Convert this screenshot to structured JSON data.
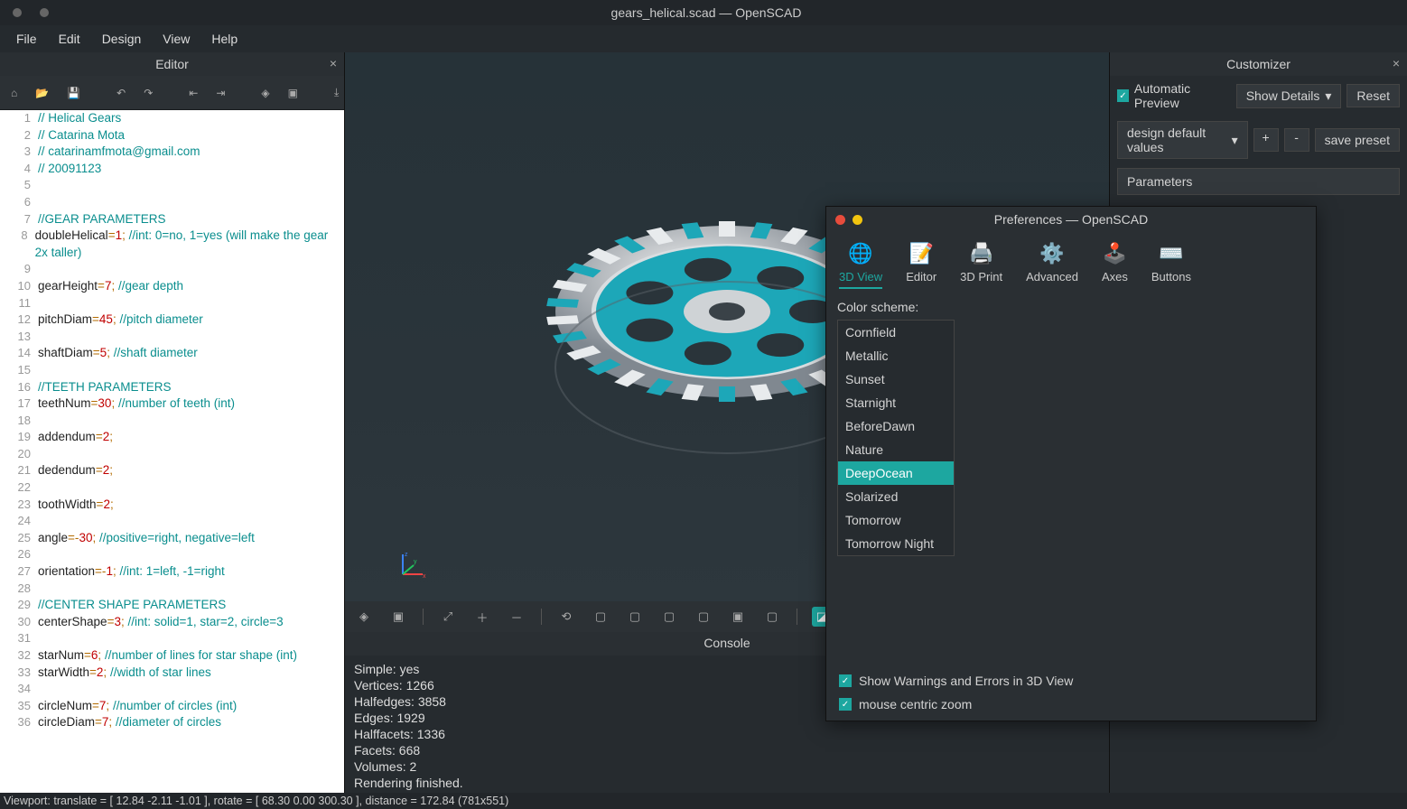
{
  "window": {
    "title": "gears_helical.scad — OpenSCAD"
  },
  "menu": {
    "file": "File",
    "edit": "Edit",
    "design": "Design",
    "view": "View",
    "help": "Help"
  },
  "editor": {
    "title": "Editor",
    "lines": [
      {
        "n": 1,
        "segs": [
          {
            "t": "// Helical Gears",
            "c": "cmt"
          }
        ]
      },
      {
        "n": 2,
        "segs": [
          {
            "t": "// Catarina Mota",
            "c": "cmt"
          }
        ]
      },
      {
        "n": 3,
        "segs": [
          {
            "t": "// catarinamfmota@gmail.com",
            "c": "cmt"
          }
        ]
      },
      {
        "n": 4,
        "segs": [
          {
            "t": "// 20091123",
            "c": "cmt"
          }
        ]
      },
      {
        "n": 5,
        "segs": []
      },
      {
        "n": 6,
        "segs": []
      },
      {
        "n": 7,
        "segs": [
          {
            "t": "//GEAR PARAMETERS",
            "c": "cmt"
          }
        ]
      },
      {
        "n": 8,
        "segs": [
          {
            "t": "doubleHelical",
            "c": ""
          },
          {
            "t": "=",
            "c": "op"
          },
          {
            "t": "1",
            "c": "num"
          },
          {
            "t": "; ",
            "c": "op"
          },
          {
            "t": "//int: 0=no, 1=yes (will make the gear 2x taller)",
            "c": "cmt"
          }
        ]
      },
      {
        "n": 9,
        "segs": []
      },
      {
        "n": 10,
        "segs": [
          {
            "t": "gearHeight",
            "c": ""
          },
          {
            "t": "=",
            "c": "op"
          },
          {
            "t": "7",
            "c": "num"
          },
          {
            "t": "; ",
            "c": "op"
          },
          {
            "t": "//gear depth",
            "c": "cmt"
          }
        ]
      },
      {
        "n": 11,
        "segs": []
      },
      {
        "n": 12,
        "segs": [
          {
            "t": "pitchDiam",
            "c": ""
          },
          {
            "t": "=",
            "c": "op"
          },
          {
            "t": "45",
            "c": "num"
          },
          {
            "t": "; ",
            "c": "op"
          },
          {
            "t": "//pitch diameter",
            "c": "cmt"
          }
        ]
      },
      {
        "n": 13,
        "segs": []
      },
      {
        "n": 14,
        "segs": [
          {
            "t": "shaftDiam",
            "c": ""
          },
          {
            "t": "=",
            "c": "op"
          },
          {
            "t": "5",
            "c": "num"
          },
          {
            "t": "; ",
            "c": "op"
          },
          {
            "t": "//shaft diameter",
            "c": "cmt"
          }
        ]
      },
      {
        "n": 15,
        "segs": []
      },
      {
        "n": 16,
        "segs": [
          {
            "t": "//TEETH PARAMETERS",
            "c": "cmt"
          }
        ]
      },
      {
        "n": 17,
        "segs": [
          {
            "t": "teethNum",
            "c": ""
          },
          {
            "t": "=",
            "c": "op"
          },
          {
            "t": "30",
            "c": "num"
          },
          {
            "t": "; ",
            "c": "op"
          },
          {
            "t": "//number of teeth (int)",
            "c": "cmt"
          }
        ]
      },
      {
        "n": 18,
        "segs": []
      },
      {
        "n": 19,
        "segs": [
          {
            "t": "addendum",
            "c": ""
          },
          {
            "t": "=",
            "c": "op"
          },
          {
            "t": "2",
            "c": "num"
          },
          {
            "t": ";",
            "c": "op"
          }
        ]
      },
      {
        "n": 20,
        "segs": []
      },
      {
        "n": 21,
        "segs": [
          {
            "t": "dedendum",
            "c": ""
          },
          {
            "t": "=",
            "c": "op"
          },
          {
            "t": "2",
            "c": "num"
          },
          {
            "t": ";",
            "c": "op"
          }
        ]
      },
      {
        "n": 22,
        "segs": []
      },
      {
        "n": 23,
        "segs": [
          {
            "t": "toothWidth",
            "c": ""
          },
          {
            "t": "=",
            "c": "op"
          },
          {
            "t": "2",
            "c": "num"
          },
          {
            "t": ";",
            "c": "op"
          }
        ]
      },
      {
        "n": 24,
        "segs": []
      },
      {
        "n": 25,
        "segs": [
          {
            "t": "angle",
            "c": ""
          },
          {
            "t": "=-",
            "c": "op"
          },
          {
            "t": "30",
            "c": "num"
          },
          {
            "t": "; ",
            "c": "op"
          },
          {
            "t": "//positive=right, negative=left",
            "c": "cmt"
          }
        ]
      },
      {
        "n": 26,
        "segs": []
      },
      {
        "n": 27,
        "segs": [
          {
            "t": "orientation",
            "c": ""
          },
          {
            "t": "=-",
            "c": "op"
          },
          {
            "t": "1",
            "c": "num"
          },
          {
            "t": "; ",
            "c": "op"
          },
          {
            "t": "//int: 1=left, -1=right",
            "c": "cmt"
          }
        ]
      },
      {
        "n": 28,
        "segs": []
      },
      {
        "n": 29,
        "segs": [
          {
            "t": "//CENTER SHAPE PARAMETERS",
            "c": "cmt"
          }
        ]
      },
      {
        "n": 30,
        "segs": [
          {
            "t": "centerShape",
            "c": ""
          },
          {
            "t": "=",
            "c": "op"
          },
          {
            "t": "3",
            "c": "num"
          },
          {
            "t": "; ",
            "c": "op"
          },
          {
            "t": "//int: solid=1, star=2, circle=3",
            "c": "cmt"
          }
        ]
      },
      {
        "n": 31,
        "segs": []
      },
      {
        "n": 32,
        "segs": [
          {
            "t": "starNum",
            "c": ""
          },
          {
            "t": "=",
            "c": "op"
          },
          {
            "t": "6",
            "c": "num"
          },
          {
            "t": "; ",
            "c": "op"
          },
          {
            "t": "//number of lines for star shape (int)",
            "c": "cmt"
          }
        ]
      },
      {
        "n": 33,
        "segs": [
          {
            "t": "starWidth",
            "c": ""
          },
          {
            "t": "=",
            "c": "op"
          },
          {
            "t": "2",
            "c": "num"
          },
          {
            "t": "; ",
            "c": "op"
          },
          {
            "t": "//width of star lines",
            "c": "cmt"
          }
        ]
      },
      {
        "n": 34,
        "segs": []
      },
      {
        "n": 35,
        "segs": [
          {
            "t": "circleNum",
            "c": ""
          },
          {
            "t": "=",
            "c": "op"
          },
          {
            "t": "7",
            "c": "num"
          },
          {
            "t": "; ",
            "c": "op"
          },
          {
            "t": "//number of circles (int)",
            "c": "cmt"
          }
        ]
      },
      {
        "n": 36,
        "segs": [
          {
            "t": "circleDiam",
            "c": ""
          },
          {
            "t": "=",
            "c": "op"
          },
          {
            "t": "7",
            "c": "num"
          },
          {
            "t": "; ",
            "c": "op"
          },
          {
            "t": "//diameter of circles",
            "c": "cmt"
          }
        ]
      }
    ]
  },
  "console": {
    "title": "Console",
    "lines": [
      "Simple: yes",
      "Vertices: 1266",
      "Halfedges: 3858",
      "Edges: 1929",
      "Halffacets: 1336",
      "Facets: 668",
      "Volumes: 2",
      "Rendering finished."
    ]
  },
  "customizer": {
    "title": "Customizer",
    "auto_preview": "Automatic Preview",
    "show_details": "Show Details",
    "reset": "Reset",
    "preset": "design default values",
    "save_preset": "save preset",
    "params_header": "Parameters"
  },
  "prefs": {
    "title": "Preferences — OpenSCAD",
    "tabs": {
      "view3d": "3D View",
      "editor": "Editor",
      "print": "3D Print",
      "advanced": "Advanced",
      "axes": "Axes",
      "buttons": "Buttons"
    },
    "scheme_label": "Color scheme:",
    "schemes": [
      "Cornfield",
      "Metallic",
      "Sunset",
      "Starnight",
      "BeforeDawn",
      "Nature",
      "DeepOcean",
      "Solarized",
      "Tomorrow",
      "Tomorrow Night"
    ],
    "selected_scheme": "DeepOcean",
    "show_warnings": "Show Warnings and Errors in 3D View",
    "mouse_zoom": "mouse centric zoom"
  },
  "statusbar": "Viewport: translate = [ 12.84 -2.11 -1.01 ],  rotate = [ 68.30 0.00 300.30 ],  distance = 172.84 (781x551)",
  "colors": {
    "accent": "#1da7a0"
  }
}
